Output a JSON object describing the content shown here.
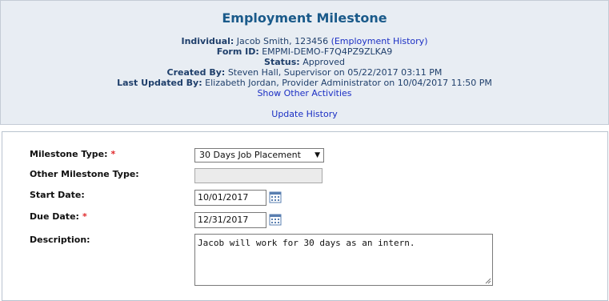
{
  "header": {
    "title": "Employment Milestone",
    "individual_label": "Individual:",
    "individual_value": "Jacob Smith, 123456",
    "employment_history_link": "(Employment History)",
    "form_id_label": "Form ID:",
    "form_id_value": "EMPMI-DEMO-F7Q4PZ9ZLKA9",
    "status_label": "Status:",
    "status_value": "Approved",
    "created_by_label": "Created By:",
    "created_by_value": "Steven Hall, Supervisor on 05/22/2017 03:11 PM",
    "last_updated_label": "Last Updated By:",
    "last_updated_value": "Elizabeth Jordan, Provider Administrator on 10/04/2017 11:50 PM",
    "show_other_activities": "Show Other Activities",
    "update_history": "Update History"
  },
  "form": {
    "milestone_type_label": "Milestone Type:",
    "milestone_type_value": "30 Days Job Placement",
    "other_milestone_type_label": "Other Milestone Type:",
    "start_date_label": "Start Date:",
    "start_date_value": "10/01/2017",
    "due_date_label": "Due Date:",
    "due_date_value": "12/31/2017",
    "description_label": "Description:",
    "description_value": "Jacob will work for 30 days as an intern.",
    "required_marker": "*"
  },
  "colors": {
    "header_bg": "#e8edf3",
    "title": "#1a5a8a",
    "link": "#1b2fc4",
    "required": "#e0292b"
  }
}
